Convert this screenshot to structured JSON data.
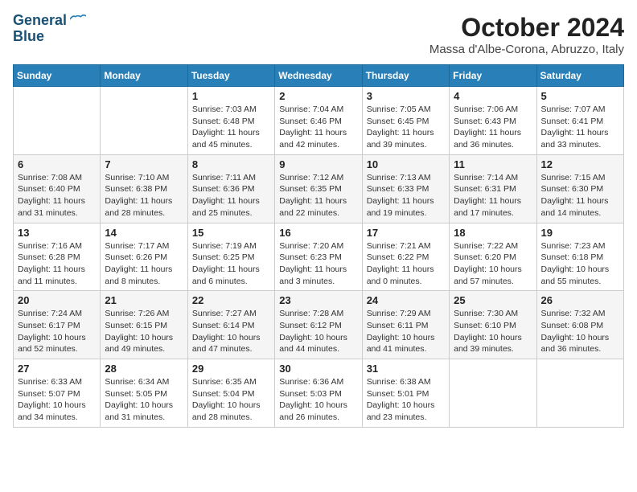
{
  "header": {
    "logo_line1": "General",
    "logo_line2": "Blue",
    "month": "October 2024",
    "location": "Massa d'Albe-Corona, Abruzzo, Italy"
  },
  "weekdays": [
    "Sunday",
    "Monday",
    "Tuesday",
    "Wednesday",
    "Thursday",
    "Friday",
    "Saturday"
  ],
  "weeks": [
    [
      {
        "day": "",
        "info": ""
      },
      {
        "day": "",
        "info": ""
      },
      {
        "day": "1",
        "info": "Sunrise: 7:03 AM\nSunset: 6:48 PM\nDaylight: 11 hours and 45 minutes."
      },
      {
        "day": "2",
        "info": "Sunrise: 7:04 AM\nSunset: 6:46 PM\nDaylight: 11 hours and 42 minutes."
      },
      {
        "day": "3",
        "info": "Sunrise: 7:05 AM\nSunset: 6:45 PM\nDaylight: 11 hours and 39 minutes."
      },
      {
        "day": "4",
        "info": "Sunrise: 7:06 AM\nSunset: 6:43 PM\nDaylight: 11 hours and 36 minutes."
      },
      {
        "day": "5",
        "info": "Sunrise: 7:07 AM\nSunset: 6:41 PM\nDaylight: 11 hours and 33 minutes."
      }
    ],
    [
      {
        "day": "6",
        "info": "Sunrise: 7:08 AM\nSunset: 6:40 PM\nDaylight: 11 hours and 31 minutes."
      },
      {
        "day": "7",
        "info": "Sunrise: 7:10 AM\nSunset: 6:38 PM\nDaylight: 11 hours and 28 minutes."
      },
      {
        "day": "8",
        "info": "Sunrise: 7:11 AM\nSunset: 6:36 PM\nDaylight: 11 hours and 25 minutes."
      },
      {
        "day": "9",
        "info": "Sunrise: 7:12 AM\nSunset: 6:35 PM\nDaylight: 11 hours and 22 minutes."
      },
      {
        "day": "10",
        "info": "Sunrise: 7:13 AM\nSunset: 6:33 PM\nDaylight: 11 hours and 19 minutes."
      },
      {
        "day": "11",
        "info": "Sunrise: 7:14 AM\nSunset: 6:31 PM\nDaylight: 11 hours and 17 minutes."
      },
      {
        "day": "12",
        "info": "Sunrise: 7:15 AM\nSunset: 6:30 PM\nDaylight: 11 hours and 14 minutes."
      }
    ],
    [
      {
        "day": "13",
        "info": "Sunrise: 7:16 AM\nSunset: 6:28 PM\nDaylight: 11 hours and 11 minutes."
      },
      {
        "day": "14",
        "info": "Sunrise: 7:17 AM\nSunset: 6:26 PM\nDaylight: 11 hours and 8 minutes."
      },
      {
        "day": "15",
        "info": "Sunrise: 7:19 AM\nSunset: 6:25 PM\nDaylight: 11 hours and 6 minutes."
      },
      {
        "day": "16",
        "info": "Sunrise: 7:20 AM\nSunset: 6:23 PM\nDaylight: 11 hours and 3 minutes."
      },
      {
        "day": "17",
        "info": "Sunrise: 7:21 AM\nSunset: 6:22 PM\nDaylight: 11 hours and 0 minutes."
      },
      {
        "day": "18",
        "info": "Sunrise: 7:22 AM\nSunset: 6:20 PM\nDaylight: 10 hours and 57 minutes."
      },
      {
        "day": "19",
        "info": "Sunrise: 7:23 AM\nSunset: 6:18 PM\nDaylight: 10 hours and 55 minutes."
      }
    ],
    [
      {
        "day": "20",
        "info": "Sunrise: 7:24 AM\nSunset: 6:17 PM\nDaylight: 10 hours and 52 minutes."
      },
      {
        "day": "21",
        "info": "Sunrise: 7:26 AM\nSunset: 6:15 PM\nDaylight: 10 hours and 49 minutes."
      },
      {
        "day": "22",
        "info": "Sunrise: 7:27 AM\nSunset: 6:14 PM\nDaylight: 10 hours and 47 minutes."
      },
      {
        "day": "23",
        "info": "Sunrise: 7:28 AM\nSunset: 6:12 PM\nDaylight: 10 hours and 44 minutes."
      },
      {
        "day": "24",
        "info": "Sunrise: 7:29 AM\nSunset: 6:11 PM\nDaylight: 10 hours and 41 minutes."
      },
      {
        "day": "25",
        "info": "Sunrise: 7:30 AM\nSunset: 6:10 PM\nDaylight: 10 hours and 39 minutes."
      },
      {
        "day": "26",
        "info": "Sunrise: 7:32 AM\nSunset: 6:08 PM\nDaylight: 10 hours and 36 minutes."
      }
    ],
    [
      {
        "day": "27",
        "info": "Sunrise: 6:33 AM\nSunset: 5:07 PM\nDaylight: 10 hours and 34 minutes."
      },
      {
        "day": "28",
        "info": "Sunrise: 6:34 AM\nSunset: 5:05 PM\nDaylight: 10 hours and 31 minutes."
      },
      {
        "day": "29",
        "info": "Sunrise: 6:35 AM\nSunset: 5:04 PM\nDaylight: 10 hours and 28 minutes."
      },
      {
        "day": "30",
        "info": "Sunrise: 6:36 AM\nSunset: 5:03 PM\nDaylight: 10 hours and 26 minutes."
      },
      {
        "day": "31",
        "info": "Sunrise: 6:38 AM\nSunset: 5:01 PM\nDaylight: 10 hours and 23 minutes."
      },
      {
        "day": "",
        "info": ""
      },
      {
        "day": "",
        "info": ""
      }
    ]
  ]
}
